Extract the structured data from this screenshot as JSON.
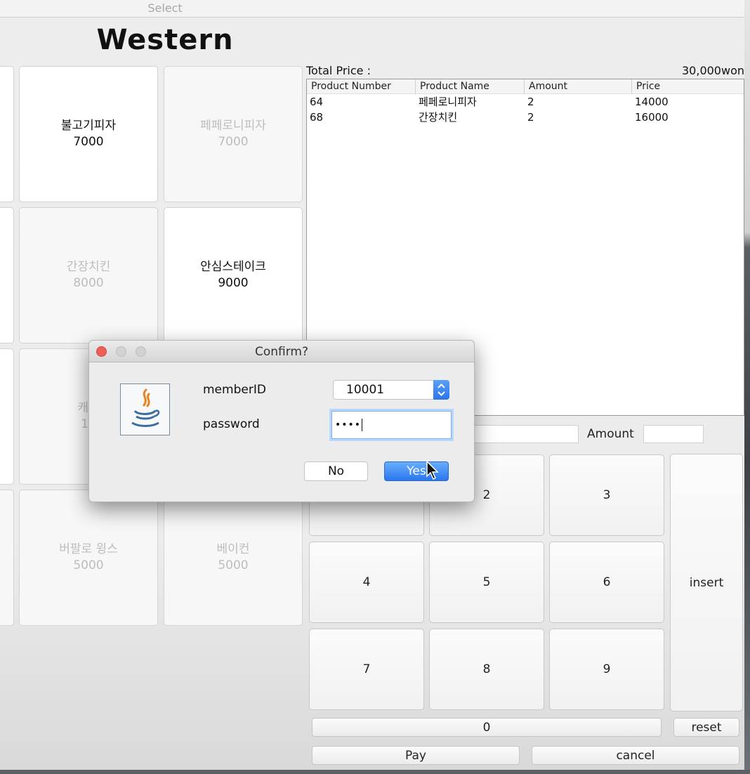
{
  "window": {
    "title": "Select"
  },
  "category": {
    "title": "Western"
  },
  "menu": {
    "items": [
      {
        "name": "불고기피자",
        "price": "7000"
      },
      {
        "name": "페페로니피자",
        "price": "7000"
      },
      {
        "name": "간장치킨",
        "price": "8000"
      },
      {
        "name": "안심스테이크",
        "price": "9000"
      },
      {
        "name": "캐비",
        "price": "12"
      },
      {
        "name": "버팔로 윙스",
        "price": "5000"
      },
      {
        "name": "베이컨",
        "price": "5000"
      }
    ]
  },
  "order": {
    "total_label": "Total Price :",
    "total_value": "30,000won",
    "columns": [
      "Product Number",
      "Product Name",
      "Amount",
      "Price"
    ],
    "rows": [
      [
        "64",
        "페페로니피자",
        "2",
        "14000"
      ],
      [
        "68",
        "간장치킨",
        "2",
        "16000"
      ]
    ]
  },
  "amount_row": {
    "label": "Amount"
  },
  "keypad": {
    "keys": [
      "2",
      "3",
      "4",
      "5",
      "6",
      "7",
      "8",
      "9"
    ],
    "insert": "insert",
    "zero": "0",
    "reset": "reset",
    "pay": "Pay",
    "cancel": "cancel"
  },
  "dialog": {
    "title": "Confirm?",
    "member_label": "memberID",
    "member_value": "10001",
    "password_label": "password",
    "password_value": "••••",
    "no_label": "No",
    "yes_label": "Yes"
  },
  "colors": {
    "accent": "#2a77ee",
    "close_dot": "#ee5f58",
    "inactive_dot": "#cfcfcf"
  },
  "icons": [
    "java-logo-icon",
    "select-stepper-icon",
    "mouse-pointer-icon"
  ]
}
